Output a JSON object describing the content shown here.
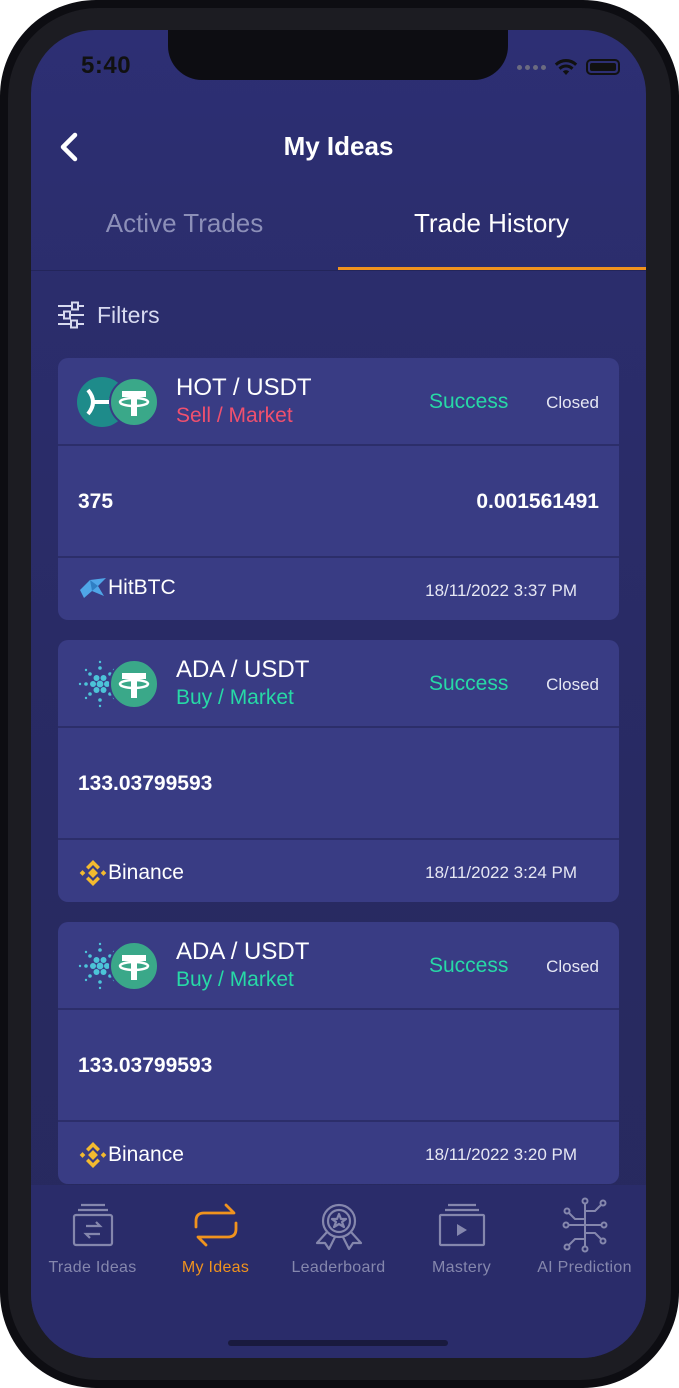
{
  "status_bar": {
    "time": "5:40"
  },
  "header": {
    "title": "My Ideas"
  },
  "tabs": [
    {
      "label": "Active Trades",
      "active": false
    },
    {
      "label": "Trade History",
      "active": true
    }
  ],
  "filters": {
    "label": "Filters"
  },
  "trades": [
    {
      "pair": "HOT / USDT",
      "side": "Sell / Market",
      "status": "Success",
      "state": "Closed",
      "amount": "375",
      "price": "0.001561491",
      "exchange": "HitBTC",
      "date": "18/11/2022 3:37 PM",
      "base_icon": "holo-coin-icon",
      "quote_icon": "tether-coin-icon",
      "exchange_icon": "hitbtc-icon"
    },
    {
      "pair": "ADA / USDT",
      "side": "Buy / Market",
      "status": "Success",
      "state": "Closed",
      "amount": "133.03799593",
      "price": "",
      "exchange": "Binance",
      "date": "18/11/2022 3:24 PM",
      "base_icon": "cardano-coin-icon",
      "quote_icon": "tether-coin-icon",
      "exchange_icon": "binance-icon"
    },
    {
      "pair": "ADA / USDT",
      "side": "Buy / Market",
      "status": "Success",
      "state": "Closed",
      "amount": "133.03799593",
      "price": "",
      "exchange": "Binance",
      "date": "18/11/2022 3:20 PM",
      "base_icon": "cardano-coin-icon",
      "quote_icon": "tether-coin-icon",
      "exchange_icon": "binance-icon"
    }
  ],
  "bottom_nav": [
    {
      "label": "Trade Ideas",
      "icon": "trade-ideas-icon",
      "active": false
    },
    {
      "label": "My Ideas",
      "icon": "swap-arrows-icon",
      "active": true
    },
    {
      "label": "Leaderboard",
      "icon": "award-badge-icon",
      "active": false
    },
    {
      "label": "Mastery",
      "icon": "video-play-icon",
      "active": false
    },
    {
      "label": "AI Prediction",
      "icon": "circuit-tree-icon",
      "active": false
    }
  ],
  "colors": {
    "background": "#2b2d6c",
    "card": "#393c84",
    "accent": "#f0931e",
    "success": "#27d9a6",
    "sell": "#f0506e",
    "buy": "#27d9a6",
    "tether": "#3aa889",
    "holo": "#1e8b8a",
    "binance": "#f3ba2f"
  }
}
